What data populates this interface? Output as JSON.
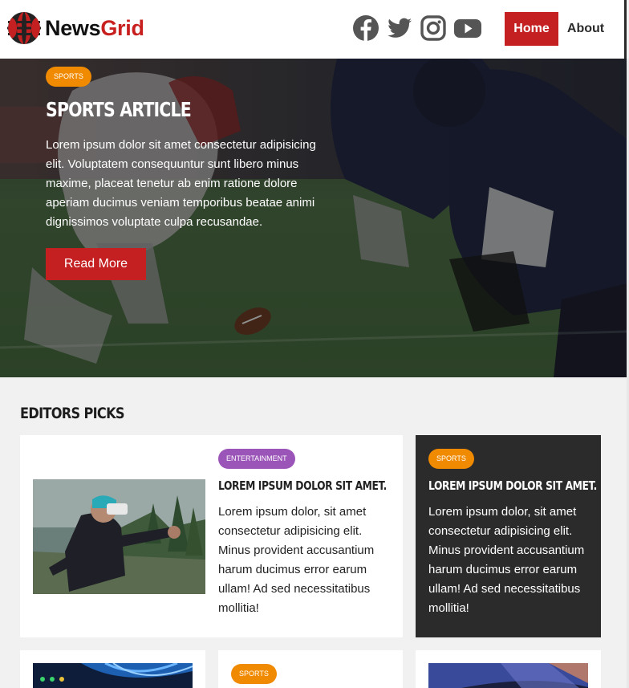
{
  "brand": {
    "name_part1": "News",
    "name_part2": "Grid",
    "accent": "#c42021"
  },
  "social": [
    {
      "icon": "facebook-icon"
    },
    {
      "icon": "twitter-icon"
    },
    {
      "icon": "instagram-icon"
    },
    {
      "icon": "youtube-icon"
    }
  ],
  "nav": {
    "home": "Home",
    "about": "About"
  },
  "hero": {
    "category": "SPORTS",
    "title": "SPORTS ARTICLE",
    "text": "Lorem ipsum dolor sit amet consectetur adipisicing elit. Voluptatem consequuntur sunt libero minus maxime, placeat tenetur ab enim ratione dolore aperiam ducimus veniam temporibus beatae animi dignissimos voluptate culpa recusandae.",
    "button": "Read More"
  },
  "editors": {
    "title": "EDITORS PICKS",
    "cards": [
      {
        "category": "ENTERTAINMENT",
        "title": "LOREM IPSUM DOLOR SIT AMET.",
        "text": "Lorem ipsum dolor, sit amet consectetur adipisicing elit. Minus provident accusantium harum ducimus error earum ullam! Ad sed necessitatibus mollitia!"
      },
      {
        "category": "SPORTS",
        "title": "LOREM IPSUM DOLOR SIT AMET.",
        "text": "Lorem ipsum dolor, sit amet consectetur adipisicing elit. Minus provident accusantium harum ducimus error earum ullam! Ad sed necessitatibus mollitia!"
      },
      {
        "category": "SPORTS"
      }
    ]
  },
  "colors": {
    "sports_badge": "#f08a00",
    "entertainment_badge": "#9b55b8",
    "dark_card": "#2b2b2b"
  }
}
